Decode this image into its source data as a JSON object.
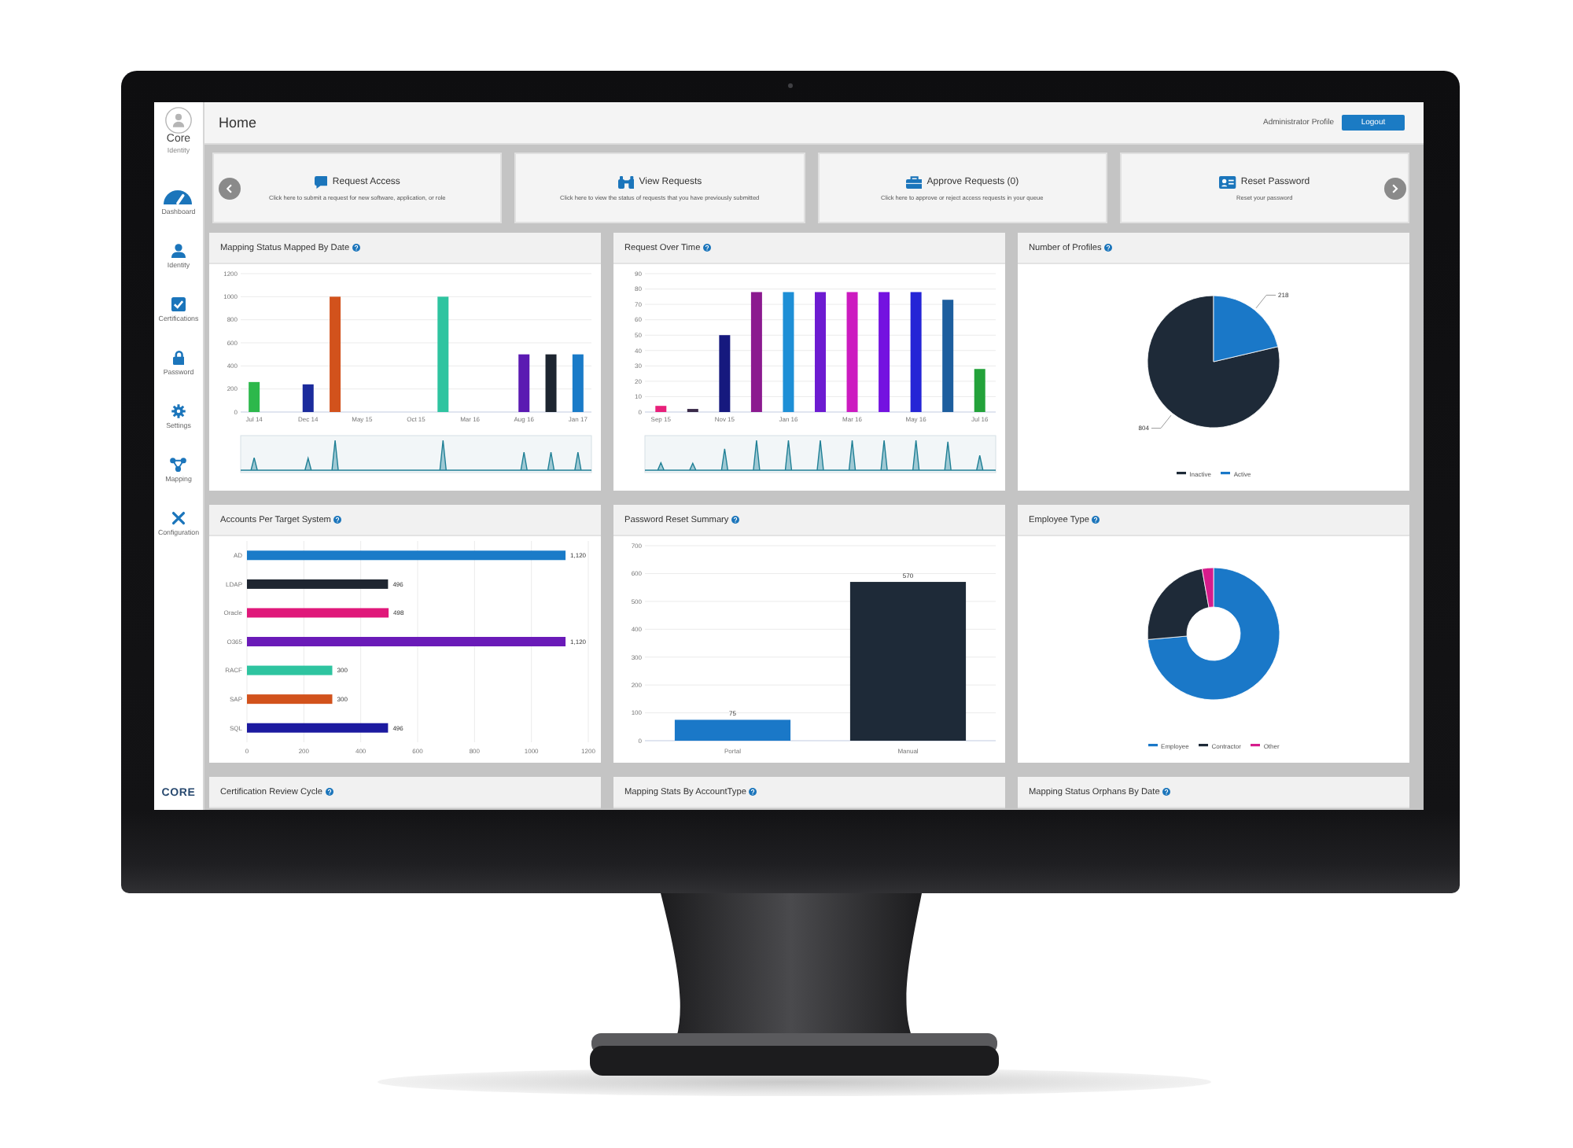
{
  "sidebar": {
    "logo": {
      "name": "Core",
      "subtitle": "Identity"
    },
    "items": [
      {
        "label": "Dashboard"
      },
      {
        "label": "Identity"
      },
      {
        "label": "Certifications"
      },
      {
        "label": "Password"
      },
      {
        "label": "Settings"
      },
      {
        "label": "Mapping"
      },
      {
        "label": "Configuration"
      }
    ],
    "footer_logo": "CORE"
  },
  "topbar": {
    "title": "Home",
    "profile": "Administrator Profile",
    "logout": "Logout"
  },
  "actions": [
    {
      "title": "Request Access",
      "description": "Click here to submit a request for new software, application, or role"
    },
    {
      "title": "View Requests",
      "description": "Click here to view the status of requests that you have previously submitted"
    },
    {
      "title": "Approve Requests (0)",
      "description": "Click here to approve or reject access requests in your queue"
    },
    {
      "title": "Reset Password",
      "description": "Reset your password"
    }
  ],
  "panels": [
    {
      "title": "Mapping Status Mapped By Date",
      "navigator": true,
      "chart_data": {
        "type": "bar",
        "categories": [
          "Jul 14",
          null,
          "Dec 14",
          null,
          "May 15",
          null,
          "Oct 15",
          null,
          "Mar 16",
          null,
          "Aug 16",
          null,
          "Jan 17"
        ],
        "values": [
          260,
          null,
          240,
          1000,
          null,
          null,
          null,
          1000,
          null,
          null,
          500,
          500,
          500
        ],
        "colors": [
          "#2db84b",
          null,
          "#1b2b9c",
          "#d2521c",
          null,
          null,
          null,
          "#2ec4a0",
          null,
          null,
          "#5b1ab2",
          "#1d2530",
          "#1a7bc8"
        ],
        "ylim": [
          0,
          1200
        ],
        "yticks": [
          0,
          200,
          400,
          600,
          800,
          1000,
          1200
        ],
        "grid": true
      }
    },
    {
      "title": "Request Over Time",
      "navigator": true,
      "chart_data": {
        "type": "bar",
        "categories": [
          "Sep 15",
          null,
          "Nov 15",
          null,
          "Jan 16",
          null,
          "Mar 16",
          null,
          "May 16",
          null,
          "Jul 16"
        ],
        "values": [
          4,
          2,
          50,
          78,
          78,
          78,
          78,
          78,
          78,
          73,
          28
        ],
        "colors": [
          "#e8207a",
          "#3a2a48",
          "#16197e",
          "#8b1a8f",
          "#1e8fd6",
          "#6d1bd1",
          "#cc1bc0",
          "#7412e0",
          "#2525d6",
          "#1d5e9e",
          "#23a23a"
        ],
        "ylim": [
          0,
          90
        ],
        "yticks": [
          0,
          10,
          20,
          30,
          40,
          50,
          60,
          70,
          80,
          90
        ],
        "grid": true
      }
    },
    {
      "title": "Number of Profiles",
      "chart_data": {
        "type": "pie",
        "categories": [
          "Inactive",
          "Active"
        ],
        "values": [
          804,
          218
        ],
        "colors": [
          "#1e2a38",
          "#1a78c8"
        ],
        "data_labels": true,
        "legend": "bottom"
      }
    },
    {
      "title": "Accounts Per Target System",
      "chart_data": {
        "type": "bar",
        "orientation": "horizontal",
        "categories": [
          "AD",
          "LDAP",
          "Oracle",
          "O365",
          "RACF",
          "SAP",
          "SQL"
        ],
        "values": [
          1120,
          496,
          498,
          1120,
          300,
          300,
          496
        ],
        "colors": [
          "#1a7bc8",
          "#1e2530",
          "#e0187a",
          "#6a1ab8",
          "#2ec4a0",
          "#d2521c",
          "#1c1aa0"
        ],
        "value_labels": [
          "1,120",
          "496",
          "498",
          "1,120",
          "300",
          "300",
          "496"
        ],
        "xlim": [
          0,
          1200
        ],
        "xticks": [
          0,
          200,
          400,
          600,
          800,
          1000,
          1200
        ],
        "grid": true
      }
    },
    {
      "title": "Password Reset Summary",
      "chart_data": {
        "type": "bar",
        "categories": [
          "Portal",
          "Manual"
        ],
        "values": [
          75,
          570
        ],
        "colors": [
          "#1a78c8",
          "#1e2a38"
        ],
        "value_labels": [
          "75",
          "570"
        ],
        "ylim": [
          0,
          700
        ],
        "yticks": [
          0,
          100,
          200,
          300,
          400,
          500,
          600,
          700
        ],
        "grid": true
      }
    },
    {
      "title": "Employee Type",
      "chart_data": {
        "type": "donut",
        "categories": [
          "Employee",
          "Contractor",
          "Other"
        ],
        "values": [
          73.6,
          23.6,
          2.8
        ],
        "colors": [
          "#1a78c8",
          "#1e2a38",
          "#d61c8c"
        ],
        "legend": "bottom"
      }
    },
    {
      "title": "Certification Review Cycle"
    },
    {
      "title": "Mapping Stats By AccountType"
    },
    {
      "title": "Mapping Status Orphans By Date"
    }
  ]
}
